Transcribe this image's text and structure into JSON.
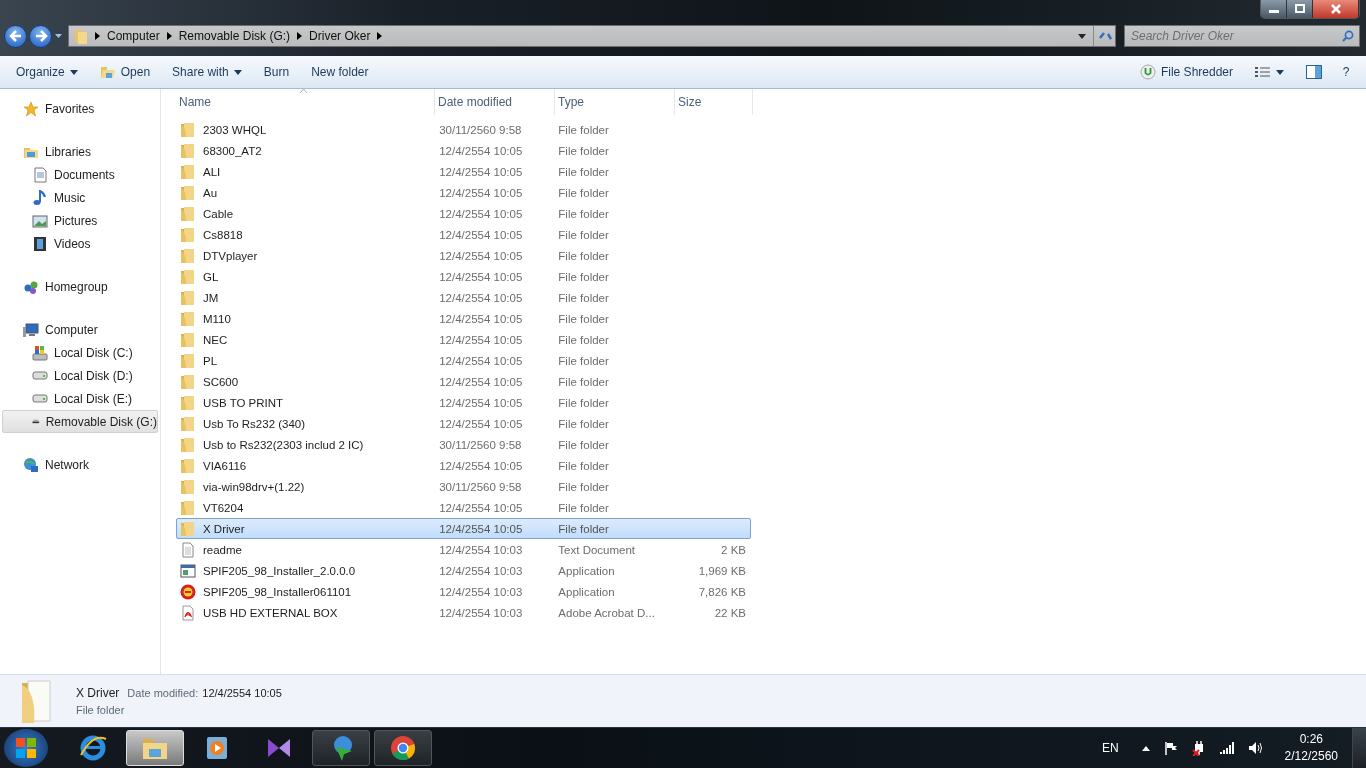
{
  "breadcrumb": [
    "Computer",
    "Removable Disk (G:)",
    "Driver Oker"
  ],
  "search": {
    "placeholder": "Search Driver Oker"
  },
  "toolbar": {
    "left": [
      {
        "label": "Organize",
        "kind": "menu"
      },
      {
        "label": "Open",
        "kind": "open"
      },
      {
        "label": "Share with",
        "kind": "menu"
      },
      {
        "label": "Burn",
        "kind": "plain"
      },
      {
        "label": "New folder",
        "kind": "plain"
      }
    ],
    "shredder": "File Shredder",
    "help": "?"
  },
  "sidebar": [
    {
      "label": "Favorites",
      "kind": "star",
      "selected": false
    },
    {
      "label": "Libraries",
      "kind": "library",
      "selected": false,
      "children": [
        {
          "label": "Documents",
          "kind": "document",
          "selected": false
        },
        {
          "label": "Music",
          "kind": "music",
          "selected": false
        },
        {
          "label": "Pictures",
          "kind": "picture",
          "selected": false
        },
        {
          "label": "Videos",
          "kind": "video",
          "selected": false
        }
      ]
    },
    {
      "label": "Homegroup",
      "kind": "homegroup",
      "selected": false
    },
    {
      "label": "Computer",
      "kind": "computer",
      "selected": false,
      "children": [
        {
          "label": "Local Disk (C:)",
          "kind": "system-disk",
          "selected": false
        },
        {
          "label": "Local Disk (D:)",
          "kind": "disk",
          "selected": false
        },
        {
          "label": "Local Disk (E:)",
          "kind": "disk",
          "selected": false
        },
        {
          "label": "Removable Disk (G:)",
          "kind": "removable",
          "selected": true
        }
      ]
    },
    {
      "label": "Network",
      "kind": "network",
      "selected": false
    }
  ],
  "table": {
    "columns": [
      "Name",
      "Date modified",
      "Type",
      "Size"
    ],
    "rows": [
      {
        "name": "2303 WHQL",
        "date": "30/11/2560 9:58",
        "type": "File folder",
        "size": "",
        "kind": "folder",
        "selected": false
      },
      {
        "name": "68300_AT2",
        "date": "12/4/2554 10:05",
        "type": "File folder",
        "size": "",
        "kind": "folder",
        "selected": false
      },
      {
        "name": "ALI",
        "date": "12/4/2554 10:05",
        "type": "File folder",
        "size": "",
        "kind": "folder",
        "selected": false
      },
      {
        "name": "Au",
        "date": "12/4/2554 10:05",
        "type": "File folder",
        "size": "",
        "kind": "folder",
        "selected": false
      },
      {
        "name": "Cable",
        "date": "12/4/2554 10:05",
        "type": "File folder",
        "size": "",
        "kind": "folder",
        "selected": false
      },
      {
        "name": "Cs8818",
        "date": "12/4/2554 10:05",
        "type": "File folder",
        "size": "",
        "kind": "folder",
        "selected": false
      },
      {
        "name": "DTVplayer",
        "date": "12/4/2554 10:05",
        "type": "File folder",
        "size": "",
        "kind": "folder",
        "selected": false
      },
      {
        "name": "GL",
        "date": "12/4/2554 10:05",
        "type": "File folder",
        "size": "",
        "kind": "folder",
        "selected": false
      },
      {
        "name": "JM",
        "date": "12/4/2554 10:05",
        "type": "File folder",
        "size": "",
        "kind": "folder",
        "selected": false
      },
      {
        "name": "M110",
        "date": "12/4/2554 10:05",
        "type": "File folder",
        "size": "",
        "kind": "folder",
        "selected": false
      },
      {
        "name": "NEC",
        "date": "12/4/2554 10:05",
        "type": "File folder",
        "size": "",
        "kind": "folder",
        "selected": false
      },
      {
        "name": "PL",
        "date": "12/4/2554 10:05",
        "type": "File folder",
        "size": "",
        "kind": "folder",
        "selected": false
      },
      {
        "name": "SC600",
        "date": "12/4/2554 10:05",
        "type": "File folder",
        "size": "",
        "kind": "folder",
        "selected": false
      },
      {
        "name": "USB TO PRINT",
        "date": "12/4/2554 10:05",
        "type": "File folder",
        "size": "",
        "kind": "folder",
        "selected": false
      },
      {
        "name": "Usb To Rs232 (340)",
        "date": "12/4/2554 10:05",
        "type": "File folder",
        "size": "",
        "kind": "folder",
        "selected": false
      },
      {
        "name": "Usb to Rs232(2303 includ 2 IC)",
        "date": "30/11/2560 9:58",
        "type": "File folder",
        "size": "",
        "kind": "folder",
        "selected": false
      },
      {
        "name": "VIA6116",
        "date": "12/4/2554 10:05",
        "type": "File folder",
        "size": "",
        "kind": "folder",
        "selected": false
      },
      {
        "name": "via-win98drv+(1.22)",
        "date": "30/11/2560 9:58",
        "type": "File folder",
        "size": "",
        "kind": "folder",
        "selected": false
      },
      {
        "name": "VT6204",
        "date": "12/4/2554 10:05",
        "type": "File folder",
        "size": "",
        "kind": "folder",
        "selected": false
      },
      {
        "name": "X Driver",
        "date": "12/4/2554 10:05",
        "type": "File folder",
        "size": "",
        "kind": "folder",
        "selected": true
      },
      {
        "name": "readme",
        "date": "12/4/2554 10:03",
        "type": "Text Document",
        "size": "2 KB",
        "kind": "text",
        "selected": false
      },
      {
        "name": "SPIF205_98_Installer_2.0.0.0",
        "date": "12/4/2554 10:03",
        "type": "Application",
        "size": "1,969 KB",
        "kind": "app",
        "selected": false
      },
      {
        "name": "SPIF205_98_Installer061101",
        "date": "12/4/2554 10:03",
        "type": "Application",
        "size": "7,826 KB",
        "kind": "setup",
        "selected": false
      },
      {
        "name": "USB HD EXTERNAL BOX",
        "date": "12/4/2554 10:03",
        "type": "Adobe Acrobat D...",
        "size": "22 KB",
        "kind": "pdf",
        "selected": false
      }
    ]
  },
  "details": {
    "name": "X Driver",
    "date_label": "Date modified:",
    "date": "12/4/2554 10:05",
    "type": "File folder"
  },
  "taskbar": {
    "apps": [
      {
        "kind": "ie",
        "selected": false
      },
      {
        "kind": "explorer",
        "selected": true
      },
      {
        "kind": "media",
        "selected": false
      },
      {
        "kind": "vs",
        "selected": false
      },
      {
        "kind": "idm",
        "selected": false
      },
      {
        "kind": "chrome",
        "selected": false
      }
    ],
    "language": "EN",
    "time": "0:26",
    "date": "2/12/2560"
  }
}
